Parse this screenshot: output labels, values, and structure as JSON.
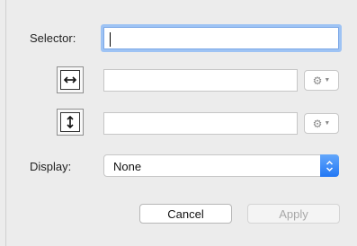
{
  "form": {
    "selector_label": "Selector:",
    "selector_value": "",
    "width_value": "",
    "height_value": "",
    "display_label": "Display:",
    "display_value": "None",
    "cancel_label": "Cancel",
    "apply_label": "Apply"
  },
  "icons": {
    "width_icon": "horizontal-arrows-icon",
    "height_icon": "vertical-arrows-icon",
    "gear": "gear-icon",
    "stepper": "up-down-chevron-icon"
  },
  "colors": {
    "focus_ring": "#9ec3f4",
    "stepper_blue": "#2277f4",
    "background": "#ececec"
  }
}
